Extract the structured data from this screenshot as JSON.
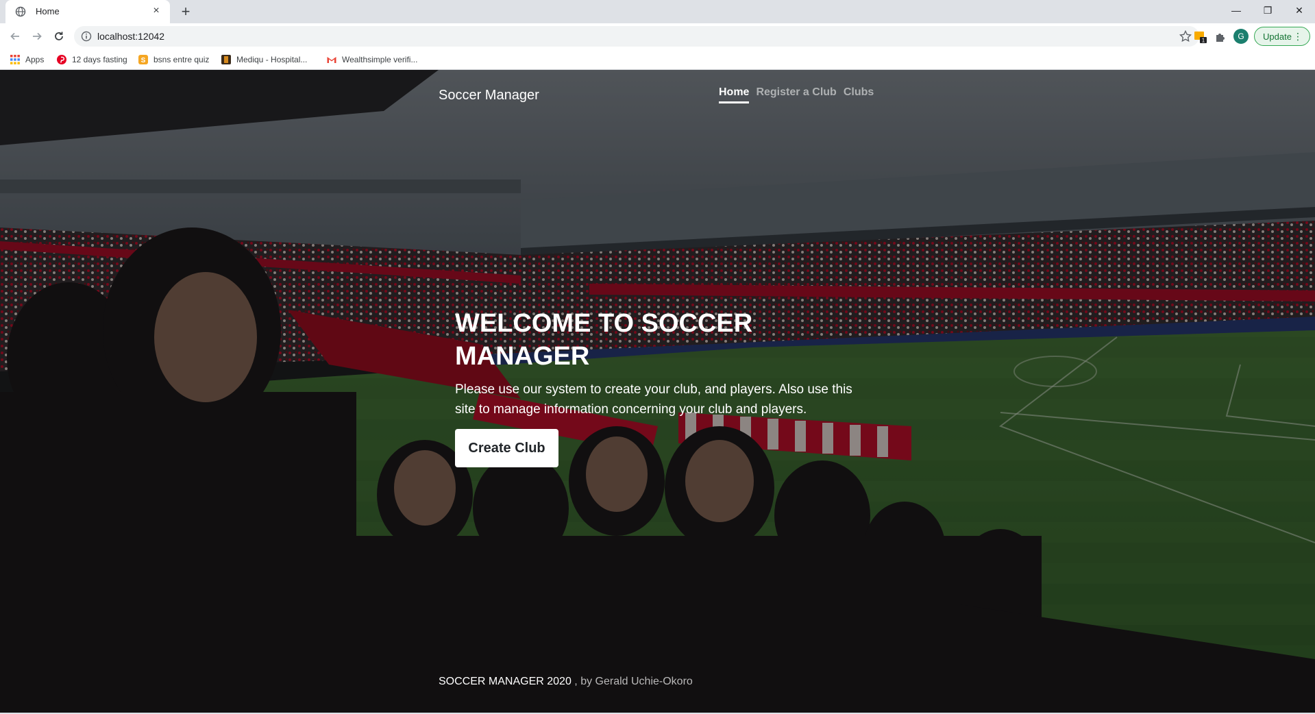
{
  "browser": {
    "tab_title": "Home",
    "tab_close": "×",
    "new_tab": "+",
    "url": "localhost:12042",
    "update_label": "Update",
    "profile_initial": "G",
    "window_controls": {
      "minimize": "—",
      "maximize": "❐",
      "close": "✕"
    },
    "bookmarks": [
      {
        "label": "Apps",
        "icon": "apps-grid-icon"
      },
      {
        "label": "12 days fasting",
        "icon": "pinterest-icon"
      },
      {
        "label": "bsns entre quiz",
        "icon": "quiz-icon"
      },
      {
        "label": "Mediqu - Hospital...",
        "icon": "mediqu-icon"
      },
      {
        "label": "Wealthsimple verifi...",
        "icon": "gmail-icon"
      }
    ]
  },
  "site": {
    "brand": "Soccer Manager",
    "nav": [
      {
        "label": "Home",
        "active": true
      },
      {
        "label": "Register a Club",
        "active": false
      },
      {
        "label": "Clubs",
        "active": false
      }
    ],
    "hero": {
      "heading": "WELCOME TO SOCCER MANAGER",
      "description": "Please use our system to create your club, and players. Also use this site to manage information concerning your club and players.",
      "cta_label": "Create Club"
    },
    "footer": {
      "title": "SOCCER MANAGER 2020",
      "byline": ", by Gerald Uchie-Okoro"
    }
  },
  "colors": {
    "chrome_bg": "#dee1e6",
    "update_green": "#34a853",
    "nav_active": "#ffffff",
    "pitch_green": "#3f6e2f",
    "crowd_red": "#c8102e"
  }
}
